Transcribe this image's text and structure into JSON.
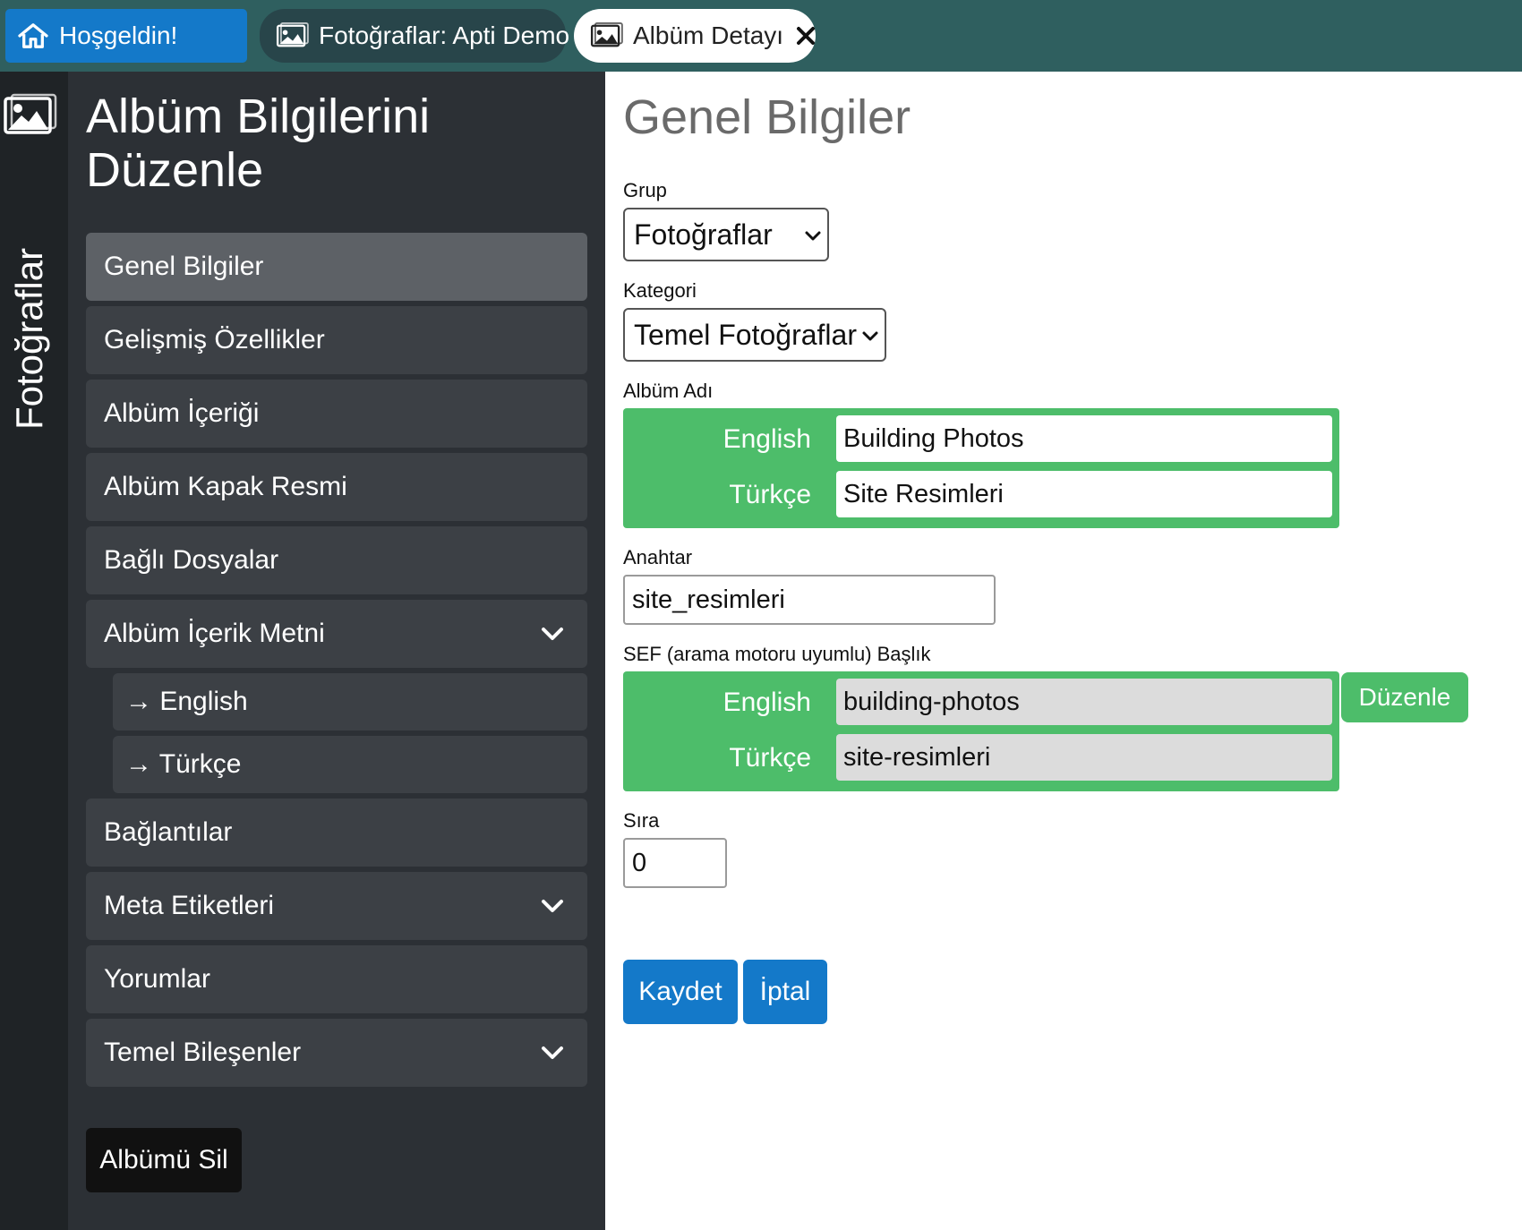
{
  "tabs": {
    "home_label": "Hoşgeldin!",
    "photos_label": "Fotoğraflar: Apti Demo",
    "detail_label": "Albüm Detayı"
  },
  "strip": {
    "label": "Fotoğraflar"
  },
  "sidebar": {
    "title": "Albüm Bilgilerini Düzenle",
    "items": [
      {
        "label": "Genel Bilgiler"
      },
      {
        "label": "Gelişmiş Özellikler"
      },
      {
        "label": "Albüm İçeriği"
      },
      {
        "label": "Albüm Kapak Resmi"
      },
      {
        "label": "Bağlı Dosyalar"
      },
      {
        "label": "Albüm İçerik Metni"
      },
      {
        "label": "→ English"
      },
      {
        "label": "→ Türkçe"
      },
      {
        "label": "Bağlantılar"
      },
      {
        "label": "Meta Etiketleri"
      },
      {
        "label": "Yorumlar"
      },
      {
        "label": "Temel Bileşenler"
      }
    ],
    "delete_label": "Albümü Sil"
  },
  "form": {
    "title": "Genel Bilgiler",
    "group_label": "Grup",
    "group_value": "Fotoğraflar",
    "category_label": "Kategori",
    "category_value": "Temel Fotoğraflar",
    "album_name_label": "Albüm Adı",
    "album_name": {
      "english_label": "English",
      "english_value": "Building Photos",
      "turkish_label": "Türkçe",
      "turkish_value": "Site Resimleri"
    },
    "key_label": "Anahtar",
    "key_value": "site_resimleri",
    "sef_label": "SEF (arama motoru uyumlu) Başlık",
    "sef": {
      "english_label": "English",
      "english_value": "building-photos",
      "turkish_label": "Türkçe",
      "turkish_value": "site-resimleri",
      "edit_label": "Düzenle"
    },
    "order_label": "Sıra",
    "order_value": "0",
    "save_label": "Kaydet",
    "cancel_label": "İptal"
  },
  "colors": {
    "topbar": "#2f5f5f",
    "accent_blue": "#1479c9",
    "accent_green": "#4dbd6a",
    "sidebar_bg": "#2c3035",
    "strip_bg": "#1f2326"
  },
  "icons": [
    "home-icon",
    "image-icon",
    "close-icon",
    "chevron-down-icon"
  ]
}
